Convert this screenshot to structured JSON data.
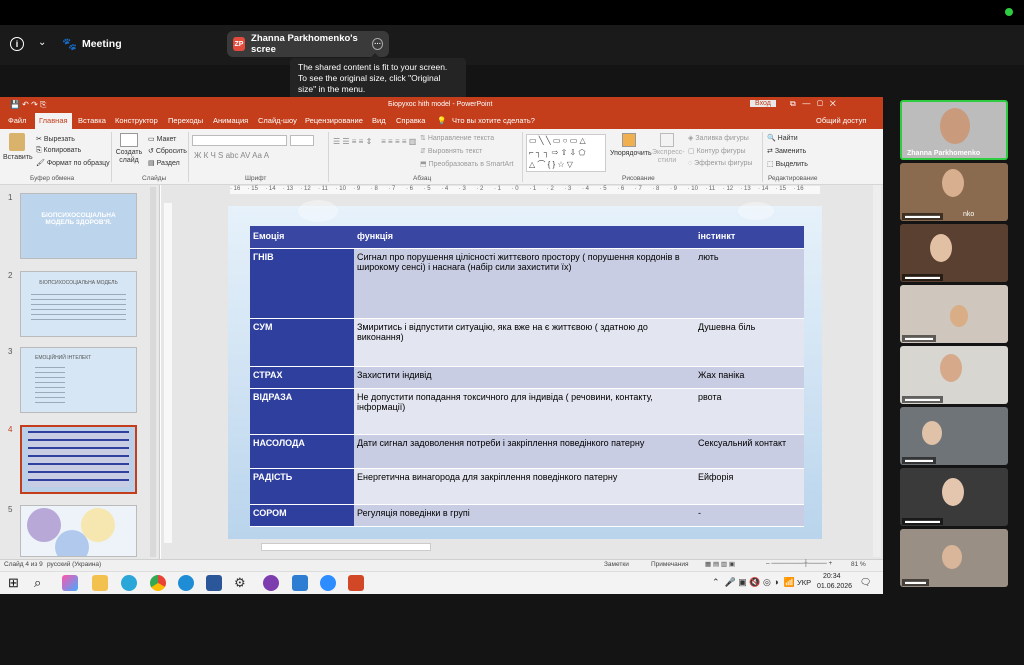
{
  "zoom": {
    "meeting_label": "Meeting",
    "share_initials": "ZP",
    "share_title": "Zhanna Parkhomenko's scree",
    "tooltip_lines": [
      "The shared content is fit to your screen.",
      "To see the original size, click \"Original",
      "size\" in the menu."
    ]
  },
  "ppt": {
    "title": "Біорухос hith model  -  PowerPoint",
    "signin": "Вход",
    "tabs": [
      "Файл",
      "Главная",
      "Вставка",
      "Конструктор",
      "Переходы",
      "Анимация",
      "Слайд-шоу",
      "Рецензирование",
      "Вид",
      "Справка"
    ],
    "tell_me": "Что вы хотите сделать?",
    "share": "Общий доступ",
    "ribbon": {
      "paste": "Вставить",
      "cut": "Вырезать",
      "copy": "Копировать",
      "format_painter": "Формат по образцу",
      "clipboard": "Буфер обмена",
      "new_slide": "Создать слайд",
      "layout": "Макет",
      "reset": "Сбросить",
      "section": "Раздел",
      "slides": "Слайды",
      "font": "Шрифт",
      "paragraph": "Абзац",
      "text_dir": "Направление текста",
      "align_text": "Выровнять текст",
      "smartart": "Преобразовать в SmartArt",
      "arrange": "Упорядочить",
      "quick_styles": "Экспресс-стили",
      "shape_fill": "Заливка фигуры",
      "shape_outline": "Контур фигуры",
      "shape_effects": "Эффекты фигуры",
      "drawing": "Рисование",
      "find": "Найти",
      "replace": "Заменить",
      "select": "Выделить",
      "editing": "Редактирование"
    },
    "thumbs": [
      {
        "n": "1",
        "title": "БІОПСИХОСОЦІАЛЬНА МОДЕЛЬ ЗДОРОВ'Я."
      },
      {
        "n": "2",
        "title": "БІОПСИХОСОЦІАЛЬНА МОДЕЛЬ"
      },
      {
        "n": "3",
        "title": "ЕМОЦІЙНИЙ ІНТЕЛЕКТ"
      },
      {
        "n": "4",
        "title": ""
      },
      {
        "n": "5",
        "title": ""
      }
    ],
    "status": {
      "slide": "Слайд 4 из 9",
      "lang": "русский (Украина)",
      "notes": "Заметки",
      "comments": "Примечания",
      "zoom": "81 %"
    }
  },
  "table": {
    "headers": [
      "Емоція",
      "функція",
      "інстинкт"
    ],
    "rows": [
      {
        "emotion": "ГНІВ",
        "function": "Сигнал про порушення цілісності життєвого простору ( порушення кордонів в широкому сенсі) і наснага (набір сили захистити їх)",
        "instinct": "лють"
      },
      {
        "emotion": "СУМ",
        "function": "Змиритись і відпустити ситуацію, яка вже на є життєвою ( здатною до виконання)",
        "instinct": "Душевна біль"
      },
      {
        "emotion": "СТРАХ",
        "function": "Захистити індивід",
        "instinct": "Жах паніка"
      },
      {
        "emotion": "ВІДРАЗА",
        "function": "Не допустити попадання токсичного для індивіда ( речовини, контакту, інформації)",
        "instinct": "рвота"
      },
      {
        "emotion": "НАСОЛОДА",
        "function": "Дати сигнал задоволення потреби і закріплення поведінкого патерну",
        "instinct": "Сексуальний контакт"
      },
      {
        "emotion": "РАДІСТЬ",
        "function": "Енергетична винагорода для закріплення поведінкого патерну",
        "instinct": "Ейфорія"
      },
      {
        "emotion": "СОРОМ",
        "function": "Регуляція поведінки в групі",
        "instinct": "-"
      }
    ]
  },
  "taskbar": {
    "lang": "УКР",
    "time": "20:34",
    "date": "01.06.2026"
  },
  "gallery": {
    "active_name": "Zhanna Parkhomenko",
    "partial_name": "nko"
  }
}
